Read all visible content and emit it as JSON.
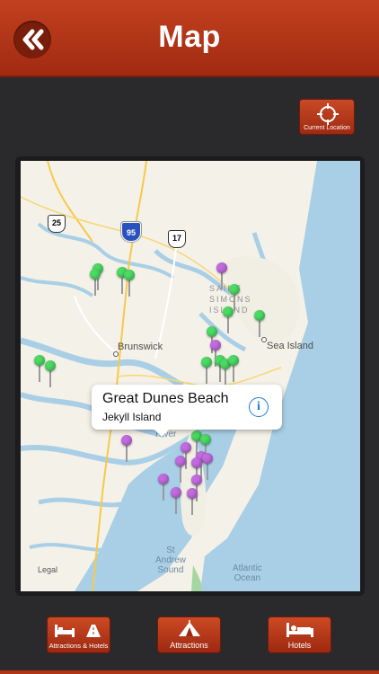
{
  "header": {
    "title": "Map",
    "back_icon": "double-chevron-left-icon"
  },
  "current_location": {
    "label": "Current Location",
    "icon": "crosshair-icon"
  },
  "map": {
    "places": [
      "Brunswick",
      "Sea Island"
    ],
    "water_labels": [
      "River",
      "St\nAndrew\nSound",
      "Atlantic\nOcean"
    ],
    "island_label": "SAINT\nSIMONS\nISLAND",
    "route_shields": [
      "25",
      "95",
      "17"
    ],
    "legal": "Legal",
    "callout": {
      "title": "Great Dunes Beach",
      "subtitle": "Jekyll Island",
      "icon": "info-icon"
    },
    "pin_colors": {
      "green": "#4cd964",
      "purple": "#c26bdf"
    }
  },
  "tabs": [
    {
      "label": "Attractions & Hotels",
      "icon": "bed-and-road-icon"
    },
    {
      "label": "Attractions",
      "icon": "tent-icon"
    },
    {
      "label": "Hotels",
      "icon": "bed-icon"
    }
  ]
}
